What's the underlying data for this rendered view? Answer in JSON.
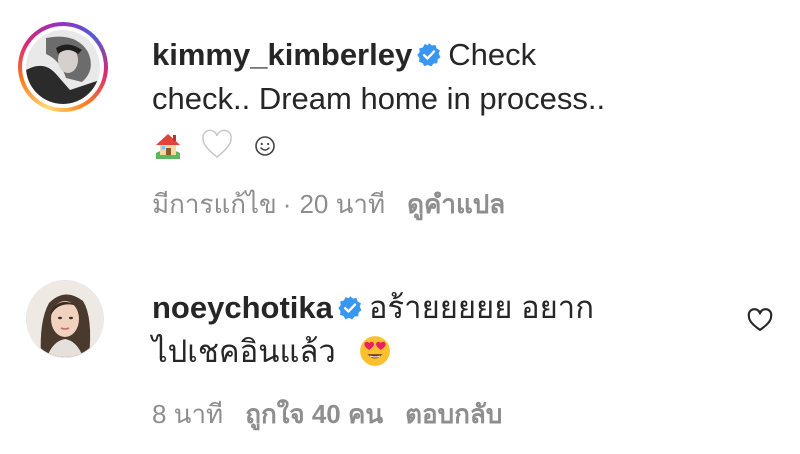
{
  "comments": [
    {
      "username": "kimmy_kimberley",
      "verified": true,
      "text_line1": "Check",
      "text_line2": "check.. Dream home in process..",
      "emojis": [
        "house-emoji",
        "white-heart-emoji",
        "smiley-emoji"
      ],
      "edited_label": "มีการแก้ไข",
      "separator": "·",
      "time": "20 นาที",
      "translate_label": "ดูคำแปล"
    },
    {
      "username": "noeychotika",
      "verified": true,
      "text_line1": "อร้ายยยยย อยาก",
      "text_line2": "ไปเชคอินแล้ว",
      "emojis": [
        "heart-eyes-emoji"
      ],
      "time": "8 นาที",
      "likes": "ถูกใจ 40 คน",
      "reply_label": "ตอบกลับ"
    }
  ],
  "colors": {
    "text": "#262626",
    "meta": "#8e8e8e",
    "verified": "#3897f0"
  }
}
